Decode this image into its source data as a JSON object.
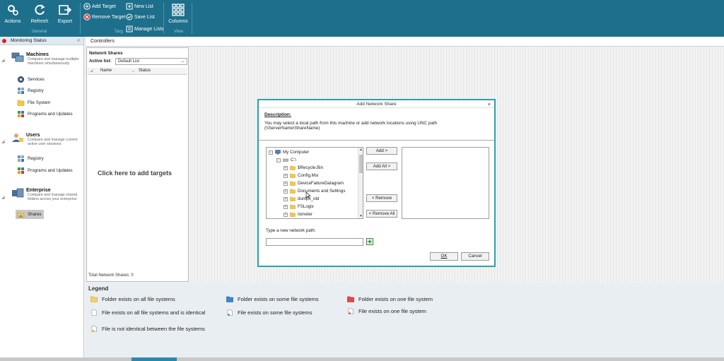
{
  "ribbon": {
    "actions": "Actions",
    "refresh": "Refresh",
    "export": "Export",
    "group_general": "General",
    "add_target": "Add Target",
    "remove_target": "Remove Target",
    "new_list": "New List",
    "save_list": "Save List",
    "manage_lists": "Manage Lists",
    "group_targets": "Targ",
    "columns": "Columns",
    "group_view": "View"
  },
  "leftnav": {
    "monitoring": "Monitoring Status",
    "collapse_glyph": "«",
    "machines": {
      "title": "Machines",
      "desc": "Compare and manage multiple machines simultaneously",
      "items": [
        "Services",
        "Registry",
        "File System",
        "Programs and Updates"
      ]
    },
    "users": {
      "title": "Users",
      "desc": "Compare and manage current active user sessions",
      "items": [
        "Registry",
        "Programs and Updates"
      ]
    },
    "enterprise": {
      "title": "Enterprise",
      "desc": "Compare and manage shared folders across your enterprise",
      "items": [
        "Shares"
      ]
    }
  },
  "controllers": {
    "title": "Controllers",
    "network_shares": "Network Shares",
    "active_list_label": "Active list:",
    "active_list_value": "Default List",
    "col_name": "Name",
    "col_status": "Status",
    "click_hint": "Click here to add targets",
    "total": "Total Network Shares: 0"
  },
  "legend": {
    "title": "Legend",
    "items": [
      "Folder exists on all file systems",
      "Folder exists on some file systems",
      "Folder exists on one file system",
      "File exists on all file systems and is identical",
      "File exists on some file systems",
      "File exists on one file system",
      "File is not identical between the file systems"
    ]
  },
  "dialog": {
    "title": "Add Network Share",
    "close": "×",
    "desc_heading": "Description:",
    "desc_text": "You may select a local path from this machine or add network locations using UNC path (\\\\ServerName\\ShareName)",
    "tree": {
      "root": "My Computer",
      "drive": "C:\\",
      "folders": [
        "$Recycle.Bin",
        "Config.Msi",
        "DeviceFailureDatagram",
        "Documents and Settings",
        "dumps_old",
        "FSLogix",
        "Iometer"
      ]
    },
    "add": "Add >",
    "add_all": "Add All >",
    "remove": "< Remove",
    "remove_all": "< Remove All",
    "network_path_label": "Type a new network path:",
    "network_path_value": "",
    "ok": "OK",
    "cancel": "Cancel"
  },
  "colors": {
    "ribbon": "#1d6f8b",
    "dialog_border": "#2ba3a8",
    "status_red": "#e02020"
  }
}
